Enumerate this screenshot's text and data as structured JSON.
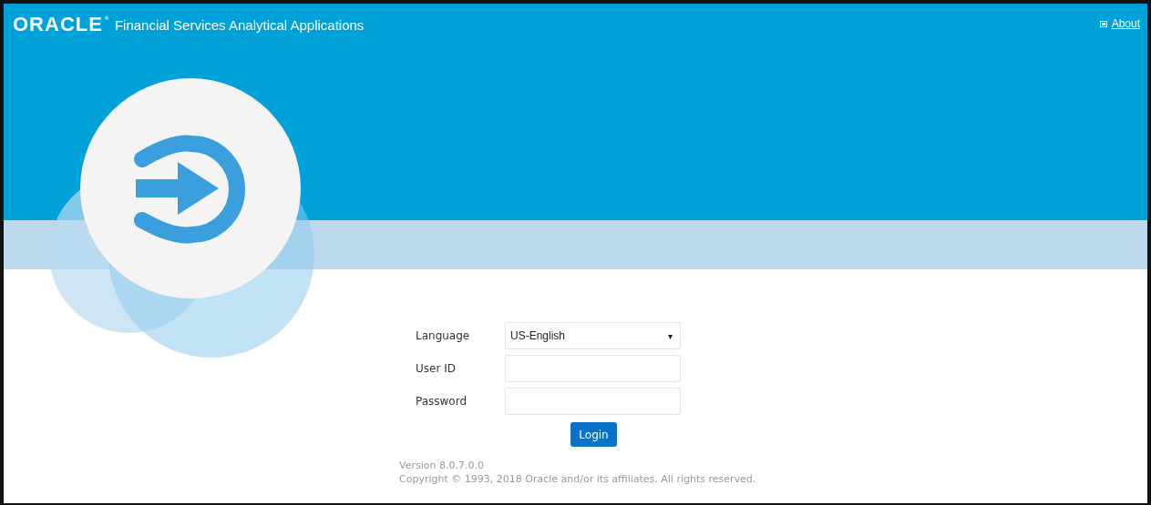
{
  "header": {
    "logo": "ORACLE",
    "registered_mark": "®",
    "title": "Financial Services Analytical Applications",
    "about_link": "About"
  },
  "login_form": {
    "fields": [
      {
        "kind": "select",
        "label": "Language",
        "value": "US-English",
        "caret": "▾"
      },
      {
        "kind": "text",
        "label": "User ID"
      },
      {
        "kind": "password",
        "label": "Password"
      }
    ],
    "submit_button": "Login"
  },
  "footer": {
    "version": "Version 8.0.7.0.0",
    "copyright": "Copyright © 1993, 2018 Oracle and/or its affiliates. All rights reserved."
  }
}
